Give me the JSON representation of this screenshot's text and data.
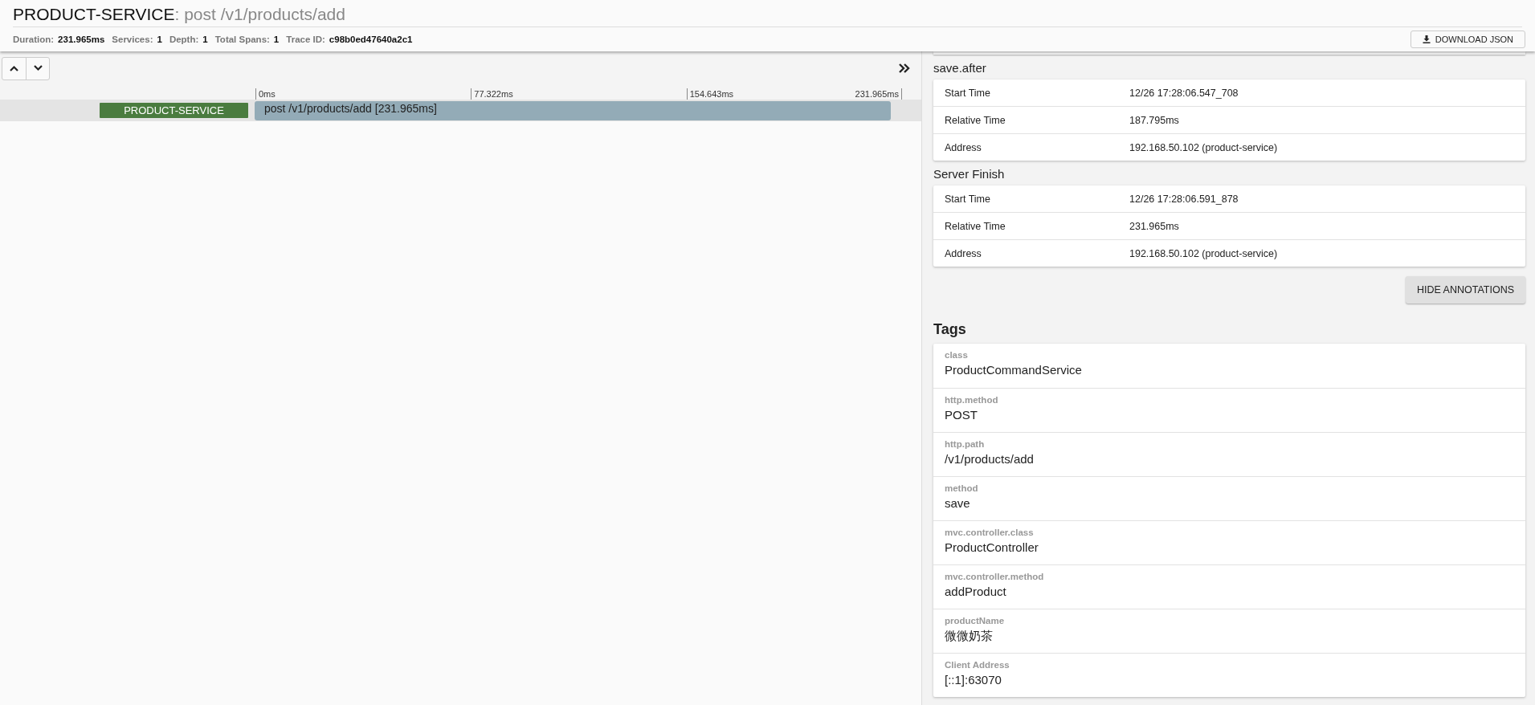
{
  "header": {
    "service": "PRODUCT-SERVICE",
    "span_name": ": post /v1/products/add",
    "stats": [
      {
        "label": "Duration:",
        "value": "231.965ms"
      },
      {
        "label": "Services:",
        "value": "1"
      },
      {
        "label": "Depth:",
        "value": "1"
      },
      {
        "label": "Total Spans:",
        "value": "1"
      },
      {
        "label": "Trace ID:",
        "value": "c98b0ed47640a2c1"
      }
    ],
    "download_button": "DOWNLOAD JSON"
  },
  "timeline": {
    "ticks": [
      "0ms",
      "77.322ms",
      "154.643ms",
      "231.965ms"
    ],
    "spans": [
      {
        "service": "PRODUCT-SERVICE",
        "label": "post /v1/products/add [231.965ms]"
      }
    ]
  },
  "annotations": [
    {
      "title": "save.after",
      "rows": [
        {
          "key": "Start Time",
          "value": "12/26 17:28:06.547_708"
        },
        {
          "key": "Relative Time",
          "value": "187.795ms"
        },
        {
          "key": "Address",
          "value": "192.168.50.102 (product-service)"
        }
      ]
    },
    {
      "title": "Server Finish",
      "rows": [
        {
          "key": "Start Time",
          "value": "12/26 17:28:06.591_878"
        },
        {
          "key": "Relative Time",
          "value": "231.965ms"
        },
        {
          "key": "Address",
          "value": "192.168.50.102 (product-service)"
        }
      ]
    }
  ],
  "hide_annotations_button": "HIDE ANNOTATIONS",
  "tags": {
    "title": "Tags",
    "items": [
      {
        "key": "class",
        "value": "ProductCommandService"
      },
      {
        "key": "http.method",
        "value": "POST"
      },
      {
        "key": "http.path",
        "value": "/v1/products/add"
      },
      {
        "key": "method",
        "value": "save"
      },
      {
        "key": "mvc.controller.class",
        "value": "ProductController"
      },
      {
        "key": "mvc.controller.method",
        "value": "addProduct"
      },
      {
        "key": "productName",
        "value": "微微奶茶"
      },
      {
        "key": "Client Address",
        "value": "[::1]:63070"
      }
    ]
  }
}
